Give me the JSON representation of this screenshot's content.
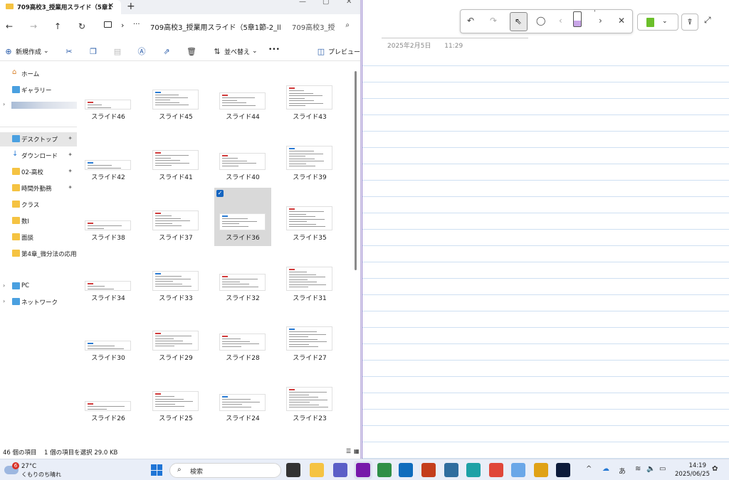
{
  "explorer": {
    "tab_title": "709高校3_授業用スライド（5章1",
    "tab_close": "✕",
    "new_tab": "+",
    "window_controls": {
      "minimize": "—",
      "maximize": "▢",
      "close": "✕"
    },
    "nav": {
      "back": "←",
      "forward": "→",
      "up": "↑",
      "refresh": "↻"
    },
    "address": {
      "chevron": "›",
      "more": "···",
      "path": "709高校3_授業用スライド（5章1節-2_ll"
    },
    "search": {
      "placeholder": "709高校3_授",
      "icon": "⌕"
    },
    "toolbar": {
      "new_label": "新規作成",
      "new_caret": "⌄",
      "sort_label": "並べ替え",
      "sort_caret": "⌄",
      "more": "•••",
      "preview_label": "プレビュー",
      "icons": [
        "cut-icon",
        "copy-icon",
        "paste-icon",
        "rename-icon",
        "share-icon",
        "delete-icon"
      ]
    },
    "sidebar": {
      "items": [
        {
          "label": "ホーム",
          "icon": "home-icon",
          "pinned": false
        },
        {
          "label": "ギャラリー",
          "icon": "gallery-icon",
          "pinned": false
        },
        {
          "label": "デスクトップ",
          "icon": "desktop-icon",
          "pinned": true
        },
        {
          "label": "ダウンロード",
          "icon": "download-icon",
          "pinned": true
        },
        {
          "label": "02-高校",
          "icon": "folder-icon",
          "pinned": true
        },
        {
          "label": "時間外勤務",
          "icon": "folder-icon",
          "pinned": true
        },
        {
          "label": "クラス",
          "icon": "folder-icon",
          "pinned": false
        },
        {
          "label": "数I",
          "icon": "folder-icon",
          "pinned": false
        },
        {
          "label": "面談",
          "icon": "folder-icon",
          "pinned": false
        },
        {
          "label": "第4章_微分法の応用",
          "icon": "folder-icon",
          "pinned": false
        },
        {
          "label": "PC",
          "icon": "pc-icon",
          "pinned": false
        },
        {
          "label": "ネットワーク",
          "icon": "network-icon",
          "pinned": false
        }
      ],
      "expand": "›",
      "pin": "📌"
    },
    "files": [
      {
        "label": "スライド46"
      },
      {
        "label": "スライド45"
      },
      {
        "label": "スライド44"
      },
      {
        "label": "スライド43"
      },
      {
        "label": "スライド42"
      },
      {
        "label": "スライド41"
      },
      {
        "label": "スライド40"
      },
      {
        "label": "スライド39"
      },
      {
        "label": "スライド38"
      },
      {
        "label": "スライド37"
      },
      {
        "label": "スライド36",
        "selected": true
      },
      {
        "label": "スライド35"
      },
      {
        "label": "スライド34"
      },
      {
        "label": "スライド33"
      },
      {
        "label": "スライド32"
      },
      {
        "label": "スライド31"
      },
      {
        "label": "スライド30"
      },
      {
        "label": "スライド29"
      },
      {
        "label": "スライド28"
      },
      {
        "label": "スライド27"
      },
      {
        "label": "スライド26"
      },
      {
        "label": "スライド25"
      },
      {
        "label": "スライド24"
      },
      {
        "label": "スライド23"
      }
    ],
    "check_mark": "✓",
    "status": {
      "count": "46 個の項目",
      "selection": "1 個の項目を選択  29.0 KB"
    }
  },
  "onenote": {
    "date": "2025年2月5日",
    "time": "11:29",
    "toolbar": {
      "undo": "↶",
      "redo": "↷",
      "select": "⇖",
      "lasso": "◯",
      "prev": "‹",
      "next": "›",
      "close": "✕",
      "caret": "⌄"
    },
    "highlighter": "⍒",
    "expand": "⤢"
  },
  "taskbar": {
    "weather": {
      "badge": "6",
      "temp": "27°C",
      "condition": "くもりのち晴れ"
    },
    "search_label": "検索",
    "search_icon": "⌕",
    "apps": [
      {
        "name": "task-view",
        "color": "#333333"
      },
      {
        "name": "file-explorer",
        "color": "#f5c342"
      },
      {
        "name": "teams",
        "color": "#5b5fc7"
      },
      {
        "name": "onenote",
        "color": "#7719aa"
      },
      {
        "name": "calendar-app",
        "color": "#2f8f46"
      },
      {
        "name": "outlook",
        "color": "#0f6cbd"
      },
      {
        "name": "powerpoint",
        "color": "#c43e1c"
      },
      {
        "name": "sway",
        "color": "#2f6d9e"
      },
      {
        "name": "edge",
        "color": "#1da1a6"
      },
      {
        "name": "app-s",
        "color": "#e0473a"
      },
      {
        "name": "onedrive-app",
        "color": "#6aa7e8"
      },
      {
        "name": "chrome",
        "color": "#e0a216"
      },
      {
        "name": "photoshop",
        "color": "#0d1b3a"
      }
    ],
    "tray": {
      "caret": "^",
      "ime": "あ",
      "wifi": "≋",
      "volume": "🔈",
      "battery": "▭"
    },
    "clock": {
      "time": "14:19",
      "date": "2025/06/25"
    }
  }
}
